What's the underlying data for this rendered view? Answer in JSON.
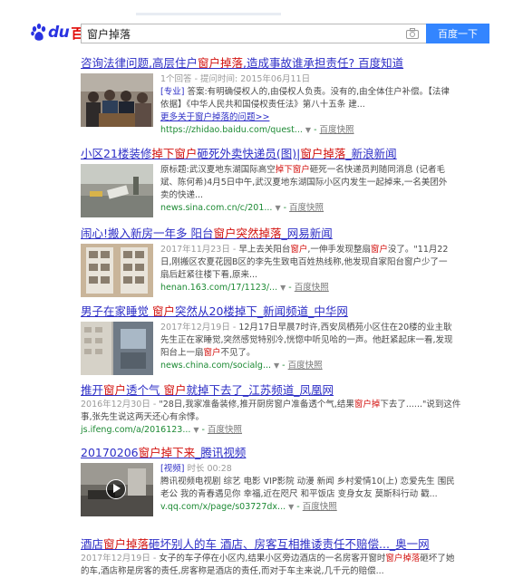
{
  "header": {
    "logo_du": "du",
    "logo_cn": "百度",
    "query": "窗户掉落",
    "search_button": "百度一下"
  },
  "results": [
    {
      "title_pre": "咨询法律问题,高层住户",
      "title_em": "窗户掉落",
      "title_post": ",造成事故谁承担责任? 百度知道",
      "meta": "1个回答 - 提问时间: 2015年06月11日",
      "snippet_tag": "[专业]",
      "snippet": " 答案:有明确侵权人的,由侵权人负责。没有的,由全体住户补偿。【法律依据】《中华人民共和国侵权责任法》第八十五条 建...",
      "more": "更多关于窗户掉落的问题>>",
      "url": "https://zhidao.baidu.com/quest...",
      "snapshot": "百度快照"
    },
    {
      "title_pre": "小区21楼装修",
      "title_em1": "掉下窗户",
      "title_mid": "砸死外卖快递员(图)|",
      "title_em2": "窗户掉落",
      "title_post": "_新浪新闻",
      "snippet_pre": "原标题:武汉夏地东湖国际高空",
      "snippet_em1": "掉下窗户",
      "snippet_post": "砸死一名快递员判随同消息 (记者毛斌、陈何希)4月5日中午,武汉夏地东湖国际小区内发生一起掉来,一名美团外卖的快递...",
      "url": "news.sina.com.cn/c/201...",
      "snapshot": "百度快照"
    },
    {
      "title_pre": "闹心!搬入新房一年多 阳台",
      "title_em": "窗户突然掉落",
      "title_post": "_网易新闻",
      "snippet_meta": "2017年11月23日 -",
      "snippet_pre": " 早上去关阳台",
      "snippet_em1": "窗户",
      "snippet_mid": ",一伸手发现整扇",
      "snippet_em2": "窗户",
      "snippet_post": "没了。\"11月22日,刚搬区农夏花园B区的李先生致电百姓热线称,他发现自家阳台窗户少了一扇后赶紧往楼下看,原来...",
      "url": "henan.163.com/17/1123/...",
      "snapshot": "百度快照"
    },
    {
      "title_pre": "男子在家睡觉 ",
      "title_em": "窗户",
      "title_post": "突然从20楼掉下_新闻频道_中华网",
      "snippet_meta": "2017年12月19日 -",
      "snippet_pre": " 12月17日早晨7时许,西安凤栖苑小区住在20楼的业主耿先生正在家睡觉,突然感觉特别冷,恍惚中听见哈的一声。他赶紧起床一看,发现阳台上一扇",
      "snippet_em": "窗户",
      "snippet_post": "不见了。",
      "url": "news.china.com/socialg...",
      "snapshot": "百度快照"
    },
    {
      "title_pre": "推开",
      "title_em1": "窗户",
      "title_mid": "透个气 ",
      "title_em2": "窗户",
      "title_post": "就掉下去了_江苏频道_凤凰网",
      "snippet_meta": "2016年12月30日 -",
      "snippet_pre": " \"28日,我家准备装修,推开厨房窗户准备透个气,结果",
      "snippet_em": "窗户掉",
      "snippet_post": "下去了......\"说到这件事,张先生说这两天还心有余悸。",
      "url": "js.ifeng.com/a/2016123...",
      "snapshot": "百度快照"
    },
    {
      "title_pre": "20170206",
      "title_em": "窗户掉下来",
      "title_post": "_腾讯视频",
      "snippet_tag": "[视频]",
      "snippet_meta": " 时长 00:28",
      "snippet": "腾讯视频电视剧 综艺 电影 VIP影院 动漫 新闻 乡村爱情10(上) 恋爱先生 围民老公 我的青春遇见你 幸福,近在咫尺 和平饭店 变身女友 莫斯科行动 戳...",
      "url": "v.qq.com/x/page/s03727dx...",
      "snapshot": "百度快照"
    },
    {
      "title_pre": "酒店",
      "title_em": "窗户掉落",
      "title_post": "砸坏别人的车 酒店、房客互相推诿责任不赔偿..._奥一网",
      "snippet_meta": "2017年12月19日 -",
      "snippet_pre": " 女子的车子停在小区内,结果小区旁边酒店的一名房客开窗时",
      "snippet_em": "窗户掉落",
      "snippet_post": "砸坏了她的车,酒店称是房客的责任,房客称是酒店的责任,而对于车主来说,几千元的赔偿..."
    }
  ]
}
